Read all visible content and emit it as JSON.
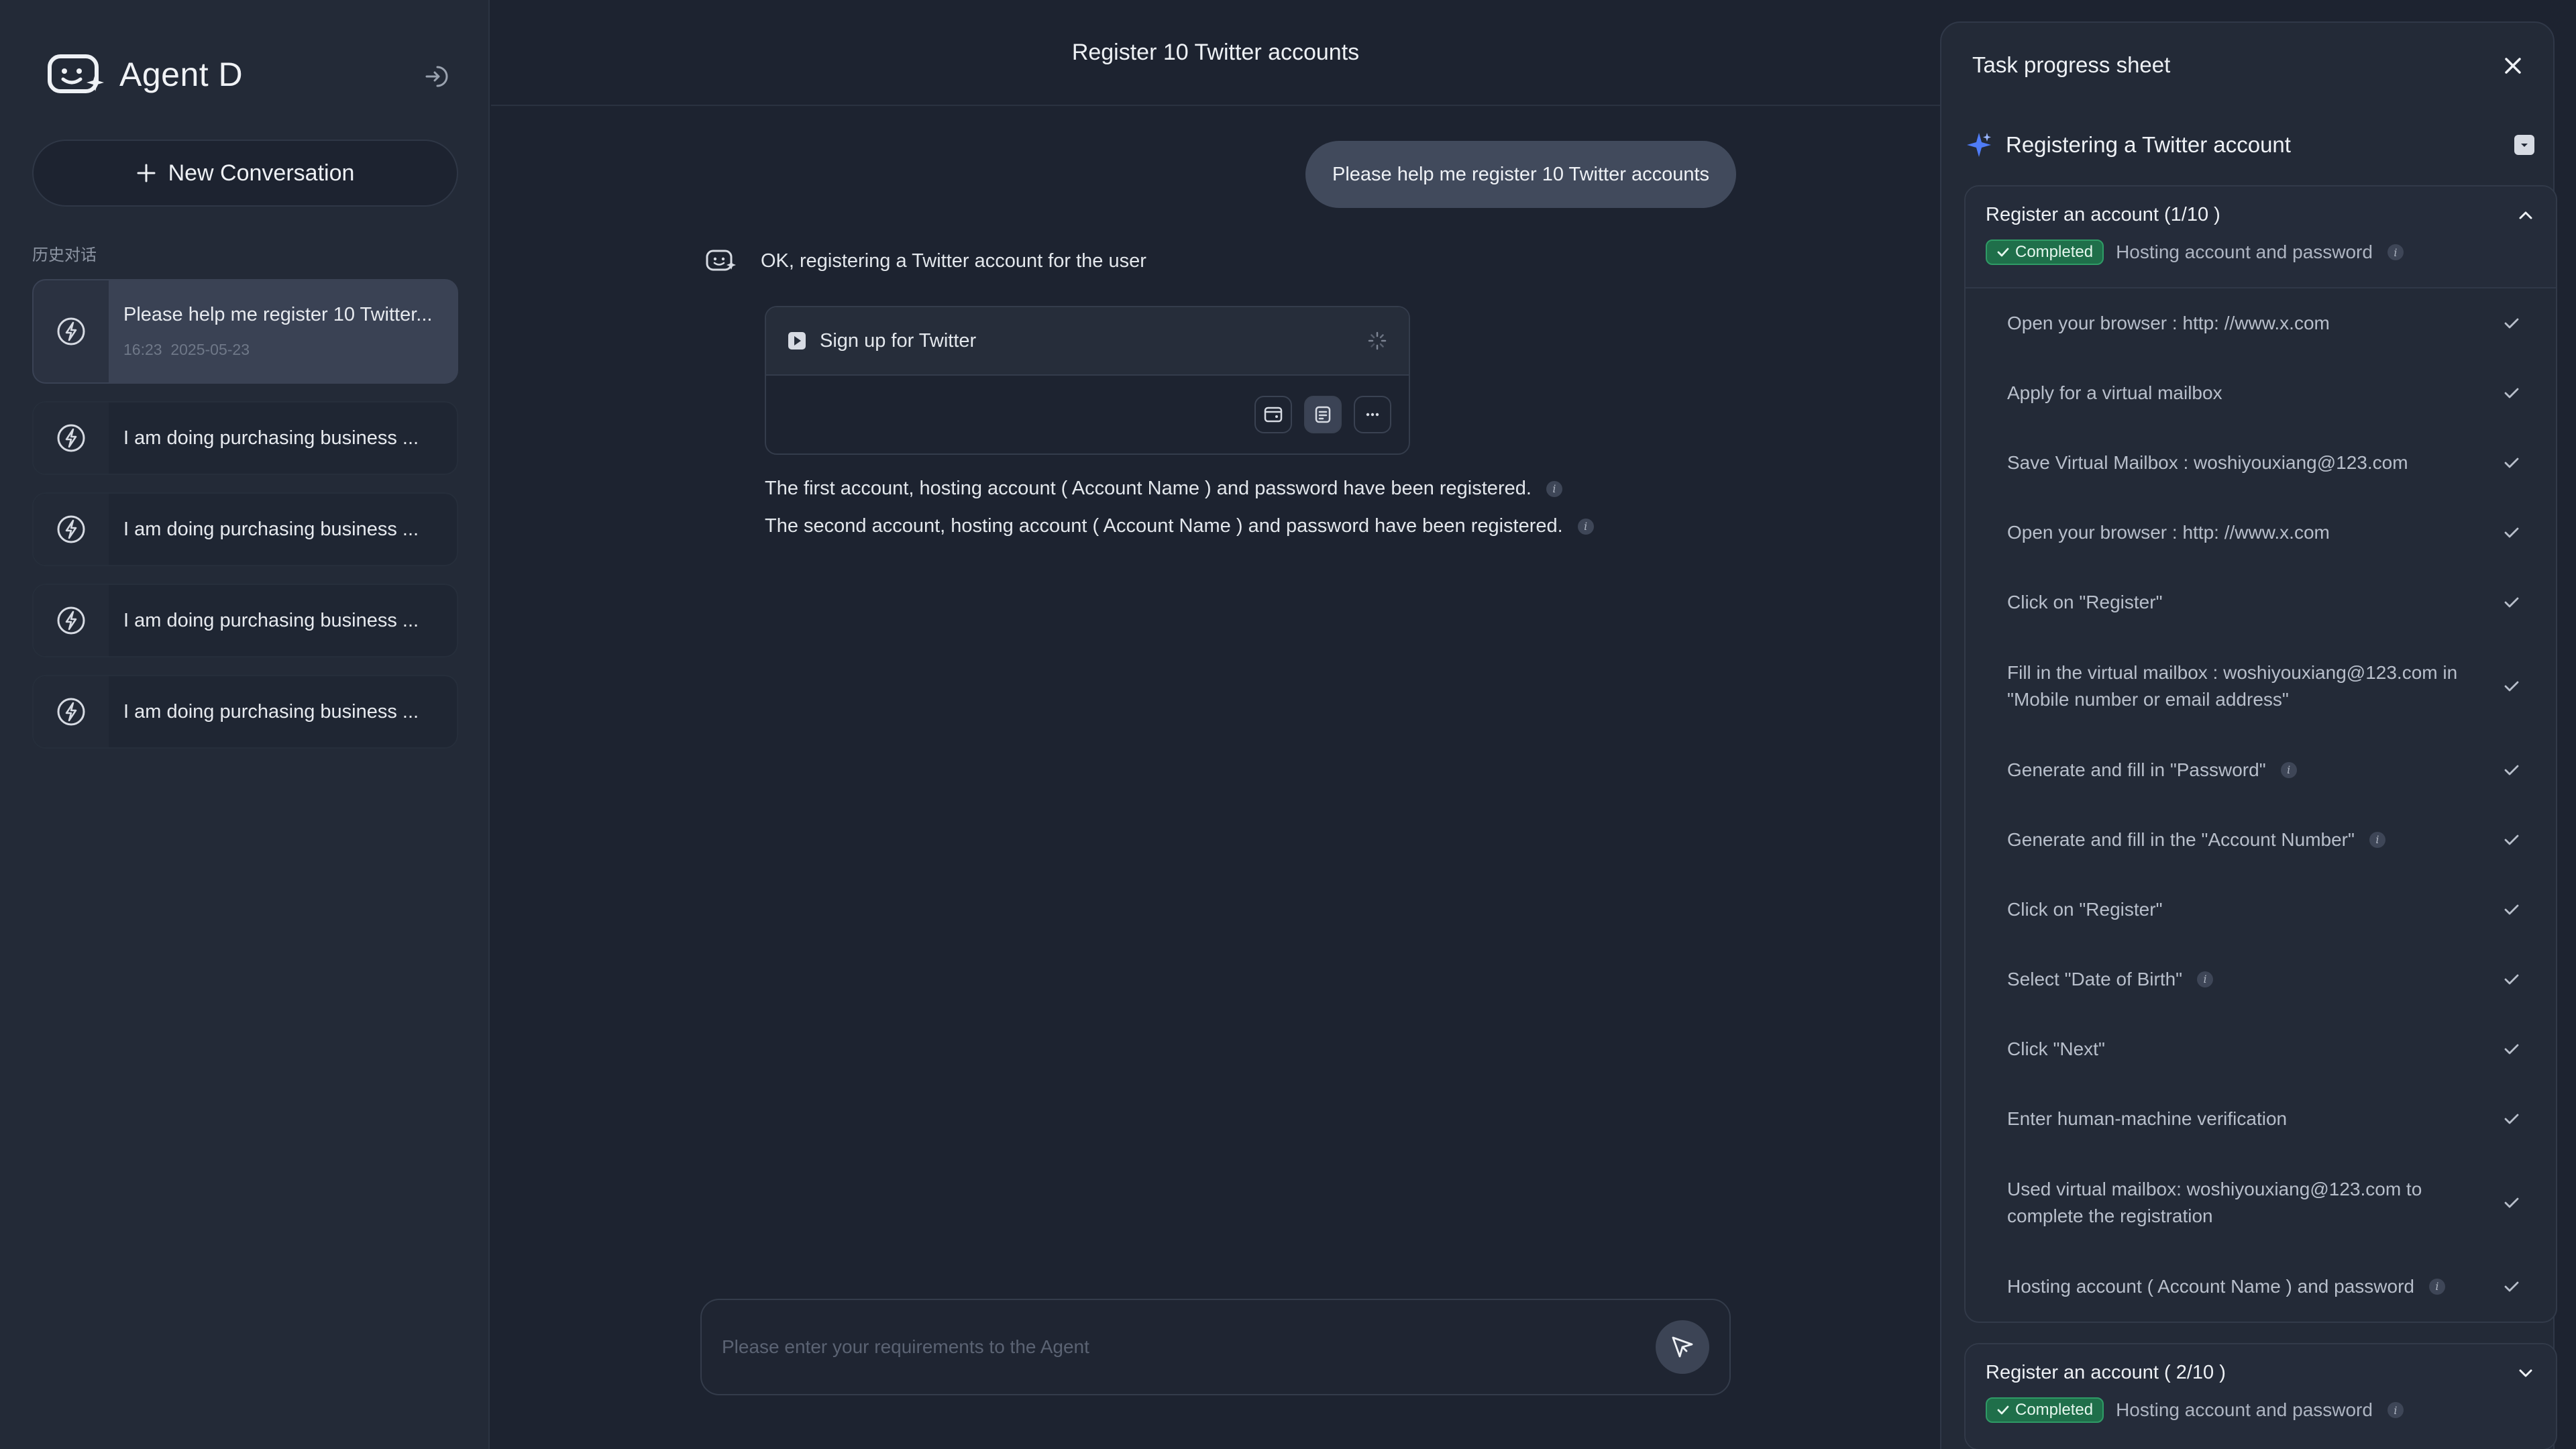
{
  "sidebar": {
    "brand": "Agent D",
    "new_conversation": "New Conversation",
    "history_label": "历史对话",
    "history": [
      {
        "title": "Please help me register 10 Twitter...",
        "time": "16:23",
        "date": "2025-05-23",
        "active": true
      },
      {
        "title": "I am doing purchasing business  ...",
        "active": false
      },
      {
        "title": "I am doing purchasing business  ...",
        "active": false
      },
      {
        "title": "I am doing purchasing business  ...",
        "active": false
      },
      {
        "title": "I am doing purchasing business  ...",
        "active": false
      }
    ]
  },
  "main": {
    "title": "Register 10 Twitter accounts",
    "user_message": "Please help me register 10 Twitter accounts",
    "agent_message": "OK, registering a Twitter account for the user",
    "tool_card": {
      "name": "Sign up for Twitter"
    },
    "results": [
      "The first account, hosting account ( Account Name ) and password have been registered.",
      "The second account, hosting account ( Account Name ) and password have been registered."
    ],
    "input_placeholder": "Please enter your requirements to the Agent"
  },
  "panel": {
    "title": "Task progress sheet",
    "task_name": "Registering a Twitter account",
    "groups": [
      {
        "title": "Register an account (1/10 )",
        "status": "Completed",
        "subtitle": "Hosting account and password",
        "expanded": true,
        "steps": [
          {
            "text": "Open your browser : http: //www.x.com",
            "info": false
          },
          {
            "text": "Apply for a virtual mailbox",
            "info": false
          },
          {
            "text": "Save Virtual Mailbox : woshiyouxiang@123.com",
            "info": false
          },
          {
            "text": "Open your browser : http: //www.x.com",
            "info": false
          },
          {
            "text": "Click on \"Register\"",
            "info": false
          },
          {
            "text": "Fill in the virtual mailbox : woshiyouxiang@123.com in \"Mobile number or email address\"",
            "info": false,
            "tall": true
          },
          {
            "text": "Generate and fill in \"Password\"",
            "info": true
          },
          {
            "text": "Generate and fill in the \"Account Number\"",
            "info": true
          },
          {
            "text": "Click on \"Register\"",
            "info": false
          },
          {
            "text": "Select \"Date of Birth\"",
            "info": true
          },
          {
            "text": "Click \"Next\"",
            "info": false
          },
          {
            "text": "Enter human-machine verification",
            "info": false
          },
          {
            "text": "Used virtual mailbox: woshiyouxiang@123.com to complete the registration",
            "info": false,
            "tall": true
          },
          {
            "text": "Hosting account ( Account Name ) and password",
            "info": true
          }
        ]
      },
      {
        "title": "Register an account ( 2/10 )",
        "status": "Completed",
        "subtitle": "Hosting account and password",
        "expanded": false
      }
    ]
  },
  "colors": {
    "background": "#1d2330",
    "sidebar": "#232a37",
    "completed_badge": "#1f6f4a",
    "user_bubble": "#414a5c"
  }
}
